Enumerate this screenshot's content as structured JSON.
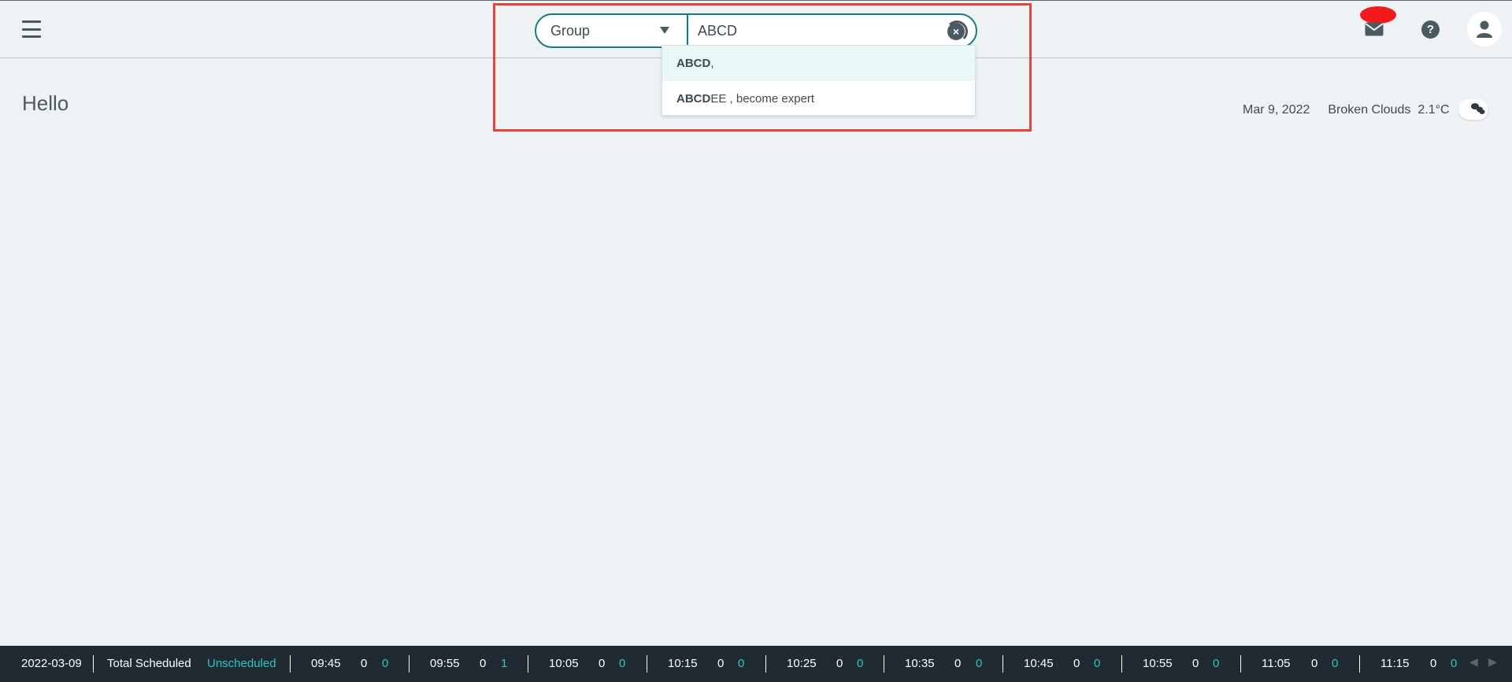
{
  "header": {
    "group_select": "Group",
    "search_value": "ABCD",
    "suggestions": [
      {
        "bold": "ABCD",
        "rest": " ,"
      },
      {
        "bold": "ABCD",
        "rest": "EE , become expert"
      }
    ]
  },
  "main": {
    "greeting": "Hello",
    "date": "Mar 9, 2022",
    "weather": "Broken Clouds",
    "temperature": "2.1°C"
  },
  "footer": {
    "date": "2022-03-09",
    "total_label": "Total Scheduled",
    "unscheduled_label": "Unscheduled",
    "slots": [
      {
        "time": "09:45",
        "scheduled": "0",
        "unscheduled": "0"
      },
      {
        "time": "09:55",
        "scheduled": "0",
        "unscheduled": "1"
      },
      {
        "time": "10:05",
        "scheduled": "0",
        "unscheduled": "0"
      },
      {
        "time": "10:15",
        "scheduled": "0",
        "unscheduled": "0"
      },
      {
        "time": "10:25",
        "scheduled": "0",
        "unscheduled": "0"
      },
      {
        "time": "10:35",
        "scheduled": "0",
        "unscheduled": "0"
      },
      {
        "time": "10:45",
        "scheduled": "0",
        "unscheduled": "0"
      },
      {
        "time": "10:55",
        "scheduled": "0",
        "unscheduled": "0"
      },
      {
        "time": "11:05",
        "scheduled": "0",
        "unscheduled": "0"
      },
      {
        "time": "11:15",
        "scheduled": "0",
        "unscheduled": "0"
      }
    ]
  },
  "colors": {
    "accent": "#127c82",
    "highlight": "#e0463b",
    "badge": "#f21a1a",
    "footer_bg": "#1f2a33",
    "teal_text": "#2ec7c0"
  },
  "icons": {
    "menu": "hamburger-menu-icon",
    "mail": "mail-icon",
    "help": "help-icon",
    "user": "user-icon",
    "clear": "clear-icon",
    "weather": "clouds-icon"
  }
}
